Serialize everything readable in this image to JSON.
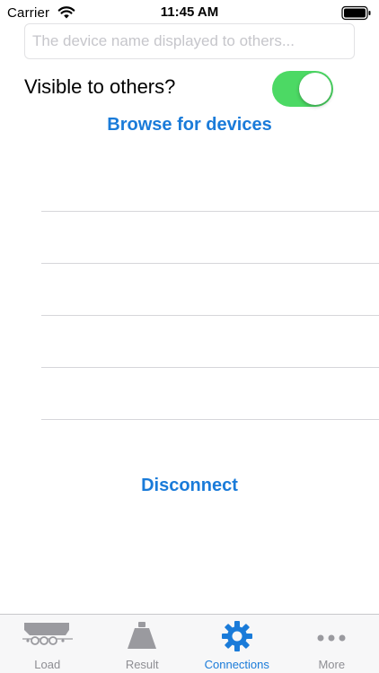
{
  "status_bar": {
    "carrier": "Carrier",
    "time": "11:45 AM"
  },
  "device_name_field": {
    "value": "",
    "placeholder": "The device name displayed to others..."
  },
  "visibility": {
    "label": "Visible to others?",
    "enabled": true,
    "on_color": "#4cd964"
  },
  "browse_label": "Browse for devices",
  "device_rows": 5,
  "disconnect_label": "Disconnect",
  "accent_color": "#1a7bd9",
  "tab_bar": {
    "tabs": [
      {
        "label": "Load",
        "icon": "trailer-icon",
        "active": false
      },
      {
        "label": "Result",
        "icon": "weight-icon",
        "active": false
      },
      {
        "label": "Connections",
        "icon": "gear-icon",
        "active": true
      },
      {
        "label": "More",
        "icon": "more-dots-icon",
        "active": false
      }
    ]
  }
}
